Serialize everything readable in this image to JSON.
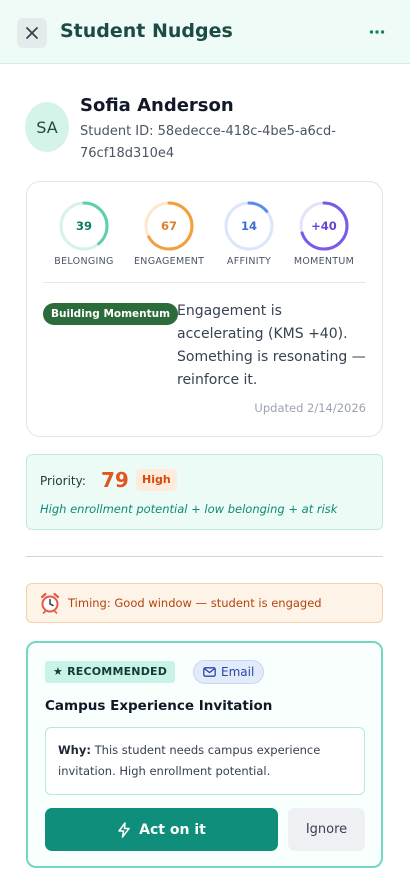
{
  "header": {
    "title": "Student Nudges",
    "close_icon": "close-icon",
    "more_icon": "more-horizontal-icon"
  },
  "student": {
    "initials": "SA",
    "name": "Sofia Anderson",
    "id_line": "Student ID: 58edecce-418c-4be5-a6cd-76cf18d310e4"
  },
  "metrics": [
    {
      "label": "BELONGING",
      "value": "39",
      "progress": 0.39,
      "color": "#5fd0a5",
      "track": "#d7f3e9",
      "text_color": "#0f7b61"
    },
    {
      "label": "ENGAGEMENT",
      "value": "67",
      "progress": 0.67,
      "color": "#f2a03b",
      "track": "#fde8cf",
      "text_color": "#d9822b"
    },
    {
      "label": "AFFINITY",
      "value": "14",
      "progress": 0.14,
      "color": "#5b8def",
      "track": "#dbe6fb",
      "text_color": "#3b6fd6"
    },
    {
      "label": "MOMENTUM",
      "value": "+40",
      "progress": 0.7,
      "color": "#7a5ae8",
      "track": "#e8e1fb",
      "text_color": "#6744d6"
    }
  ],
  "state": {
    "badge": "Building Momentum",
    "description": "Engagement is accelerating (KMS +40). Something is resonating — reinforce it.",
    "updated": "Updated 2/14/2026"
  },
  "priority": {
    "label": "Priority:",
    "score": "79",
    "level": "High",
    "reason": "High enrollment potential + low belonging + at risk"
  },
  "timing": {
    "icon": "alarm-clock-icon",
    "text": "Timing: Good window — student is engaged"
  },
  "recommendation": {
    "badge": "★ RECOMMENDED",
    "channel": "Email",
    "channel_icon": "mail-icon",
    "title": "Campus Experience Invitation",
    "why_label": "Why:",
    "why_text": " This student needs campus experience invitation. High enrollment potential.",
    "act_label": "Act on it",
    "act_icon": "lightning-icon",
    "ignore_label": "Ignore"
  },
  "colors": {
    "accent": "#0f8f7b",
    "priority_score": "#e0561d"
  }
}
